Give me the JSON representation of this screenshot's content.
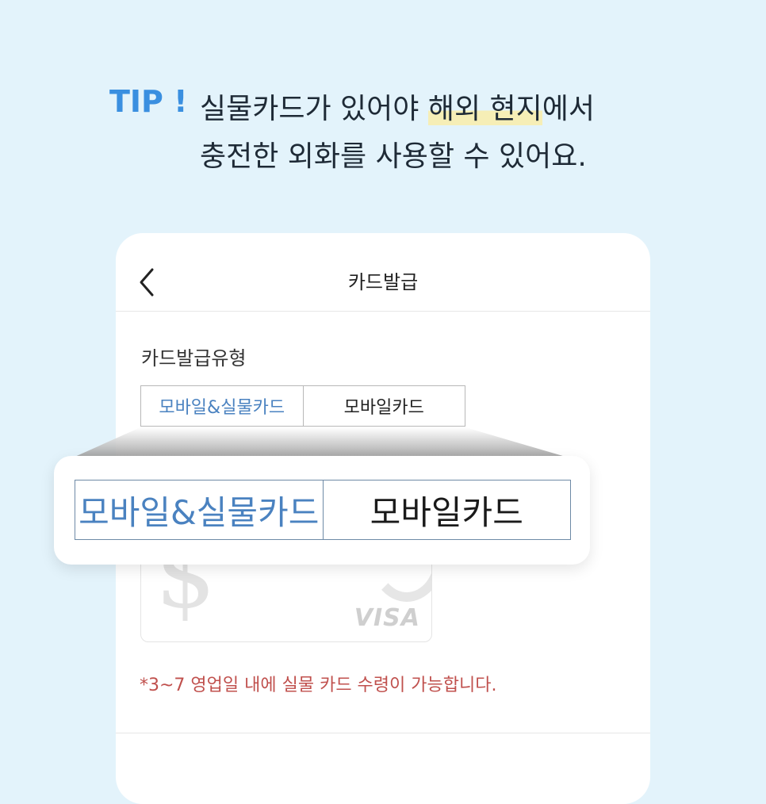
{
  "tip": {
    "label": "TIP !",
    "line1_a": "실물카드가 있어야 ",
    "line1_highlight": "해외 현지",
    "line1_b": "에서",
    "line2": "충전한 외화를 사용할 수 있어요."
  },
  "screen": {
    "title": "카드발급",
    "back_icon": "chevron-left-icon",
    "section_label": "카드발급유형",
    "options": {
      "selected": "모바일&실물카드",
      "other": "모바일카드"
    },
    "card": {
      "brand": "VISA",
      "symbol": "$"
    },
    "notice": "*3~7 영업일 내에 실물 카드 수령이 가능합니다."
  },
  "colors": {
    "background": "#e3f3fb",
    "tip_blue": "#3a8fe0",
    "active_option": "#4a82c0",
    "notice_red": "#c0504d",
    "highlight": "#f6eeb6"
  }
}
